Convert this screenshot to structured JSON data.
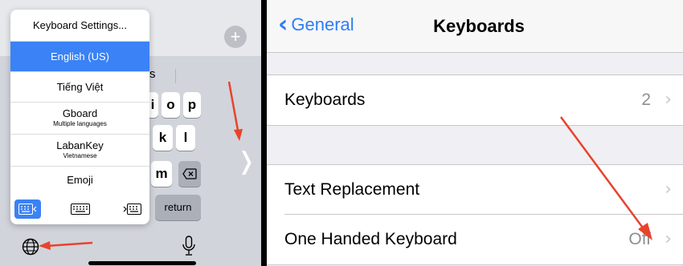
{
  "keyboard_menu": {
    "items": [
      {
        "title": "Keyboard Settings...",
        "subtitle": ""
      },
      {
        "title": "English (US)",
        "subtitle": "",
        "selected": true
      },
      {
        "title": "Tiếng Việt",
        "subtitle": ""
      },
      {
        "title": "Gboard",
        "subtitle": "Multiple languages"
      },
      {
        "title": "LabanKey",
        "subtitle": "Vietnamese"
      },
      {
        "title": "Emoji",
        "subtitle": ""
      }
    ],
    "layout_options": [
      "left-handed-keyboard-icon",
      "full-keyboard-icon",
      "right-handed-keyboard-icon"
    ]
  },
  "keyboard": {
    "suggestion": "s",
    "row1": [
      "i",
      "o",
      "p"
    ],
    "row2": [
      "k",
      "l"
    ],
    "row3": [
      "m"
    ],
    "delete_icon": "delete-icon",
    "return_label": "return",
    "collapse_icon": "chevron-right-icon",
    "plus_icon": "plus-icon",
    "globe_icon": "globe-icon",
    "mic_icon": "microphone-icon"
  },
  "settings": {
    "back_label": "General",
    "title": "Keyboards",
    "rows": {
      "keyboards": {
        "label": "Keyboards",
        "value": "2"
      },
      "text_replacement": {
        "label": "Text Replacement",
        "value": ""
      },
      "one_handed": {
        "label": "One Handed Keyboard",
        "value": "Off"
      }
    }
  },
  "colors": {
    "accent": "#3a82f6",
    "ios_blue": "#2f7cf6",
    "annotation_arrow": "#e8432c"
  }
}
